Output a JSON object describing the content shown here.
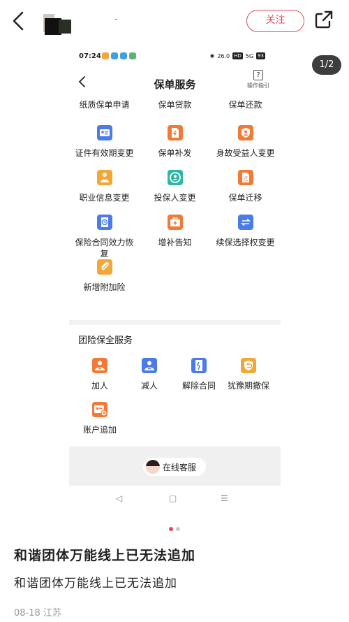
{
  "header": {
    "username": "-",
    "follow_label": "关注",
    "colors": {
      "accent": "#e14a5e"
    }
  },
  "image_counter": "1/2",
  "phone": {
    "status_bar": {
      "time": "07:24",
      "network": "26.0",
      "hd": "HD",
      "signal": "5G",
      "battery": "93"
    },
    "header": {
      "title": "保单服务",
      "help_icon_text": "?",
      "help_label": "操作指引"
    },
    "service_grid": [
      {
        "label": "纸质保单申请",
        "icon": "none",
        "color": ""
      },
      {
        "label": "保单贷款",
        "icon": "none",
        "color": ""
      },
      {
        "label": "保单还款",
        "icon": "none",
        "color": ""
      },
      {
        "label": "证件有效期变更",
        "icon": "id-card-icon",
        "color": "#4a7be8"
      },
      {
        "label": "保单补发",
        "icon": "document-reissue-icon",
        "color": "#f07a36"
      },
      {
        "label": "身故受益人变更",
        "icon": "beneficiary-icon",
        "color": "#f07a36"
      },
      {
        "label": "职业信息变更",
        "icon": "occupation-icon",
        "color": "#f2a838"
      },
      {
        "label": "投保人变更",
        "icon": "refresh-person-icon",
        "color": "#2cb6a3"
      },
      {
        "label": "保单迁移",
        "icon": "migrate-icon",
        "color": "#f07a36"
      },
      {
        "label": "保险合同效力恢复",
        "icon": "restore-icon",
        "color": "#4a7be8"
      },
      {
        "label": "增补告知",
        "icon": "medical-kit-icon",
        "color": "#f07a36"
      },
      {
        "label": "续保选择权变更",
        "icon": "swap-icon",
        "color": "#4a7be8"
      },
      {
        "label": "新增附加险",
        "icon": "paperclip-icon",
        "color": "#f2a838"
      }
    ],
    "group_section": {
      "title": "团险保全服务",
      "items": [
        {
          "label": "加人",
          "icon": "add-person-icon",
          "color": "#f07a36"
        },
        {
          "label": "减人",
          "icon": "remove-person-icon",
          "color": "#4a7be8"
        },
        {
          "label": "解除合同",
          "icon": "cancel-contract-icon",
          "color": "#4a7be8"
        },
        {
          "label": "犹豫期撤保",
          "icon": "undo-icon",
          "color": "#f2a838"
        },
        {
          "label": "账户追加",
          "icon": "account-add-icon",
          "color": "#f07a36"
        }
      ]
    },
    "customer_service": {
      "label": "在线客服"
    },
    "nav": {
      "back": "◁",
      "home": "▢",
      "menu": "☰"
    }
  },
  "post": {
    "title": "和谐团体万能线上已无法追加",
    "body": "和谐团体万能线上已无法追加",
    "meta": "08-18 江苏"
  },
  "pager": {
    "active_color": "#e14a5e",
    "inactive_color": "#cccccc"
  }
}
